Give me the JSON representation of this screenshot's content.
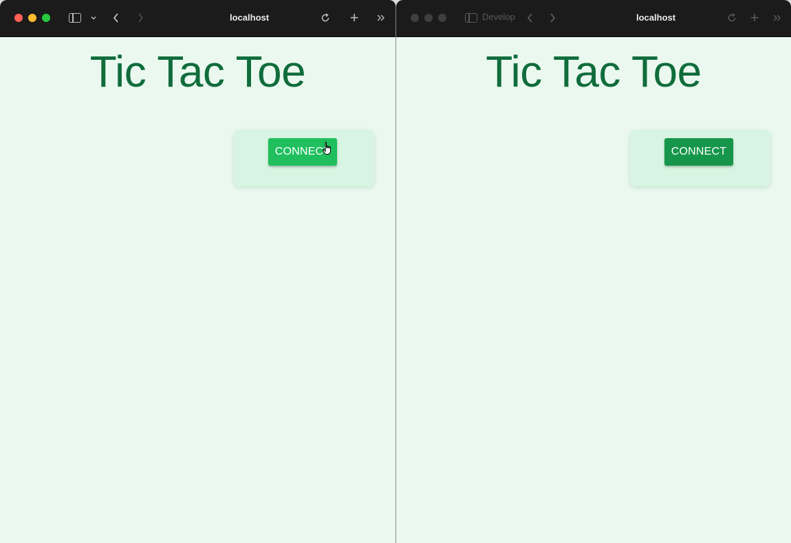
{
  "windows": [
    {
      "id": "left",
      "state": "active",
      "address": "localhost",
      "page_title": "Tic Tac Toe",
      "connect_label": "CONNECT",
      "button_color": "#1fbf5e",
      "cursor": "pointer-hand-icon"
    },
    {
      "id": "right",
      "state": "inactive",
      "address": "localhost",
      "tab_ghost": "Develop",
      "page_title": "Tic Tac Toe",
      "connect_label": "CONNECT",
      "button_color": "#15964a"
    }
  ],
  "colors": {
    "page_background": "#eaf8ef",
    "title": "#106c3b",
    "panel": "#d7f5e2",
    "toolbar": "#1b1b1b"
  },
  "icons": {
    "sidebar": "sidebar-toggle-icon",
    "chevron": "chevron-down-icon",
    "back": "back-arrow-icon",
    "forward": "forward-arrow-icon",
    "reload": "reload-icon",
    "new_tab": "plus-icon",
    "overflow": "double-chevron-right-icon"
  }
}
